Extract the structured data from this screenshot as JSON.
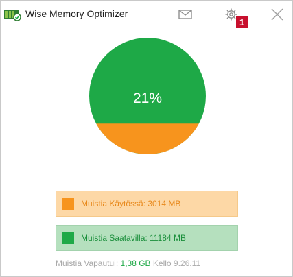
{
  "window": {
    "title": "Wise Memory Optimizer"
  },
  "titlebar": {
    "mail_icon": "mail-icon",
    "settings_icon": "gear-icon",
    "close_icon": "close-icon",
    "annotation_badge": "1"
  },
  "memory": {
    "used_percent": 21,
    "percent_label": "21%",
    "used_label": "Muistia Käytössä: 3014 MB",
    "available_label": "Muistia Saatavilla: 11184 MB"
  },
  "footer": {
    "freed_prefix": "Muistia Vapautui:",
    "freed_value": "1,38 GB",
    "time_prefix": "Kello",
    "time_value": "9.26.11"
  },
  "colors": {
    "used": "#f7941d",
    "available": "#1ea947",
    "used_bg": "#fdd8a6",
    "available_bg": "#b5e0be",
    "badge": "#c8102e"
  }
}
